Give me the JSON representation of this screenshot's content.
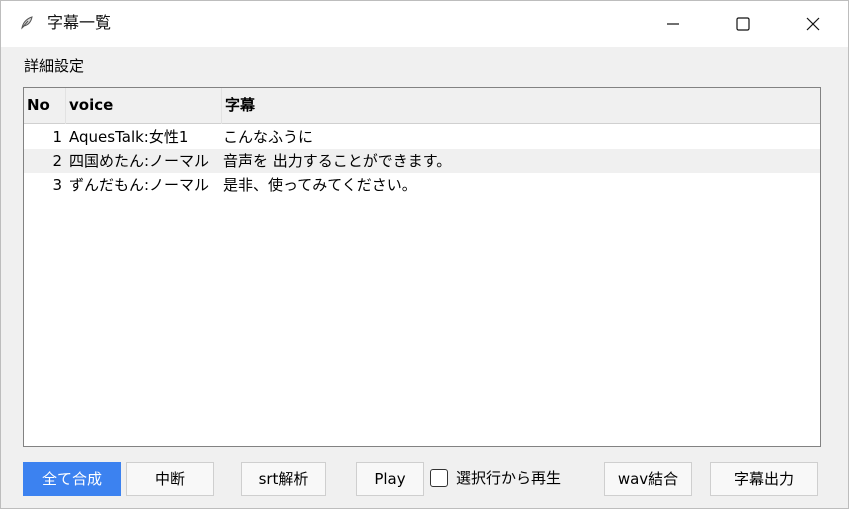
{
  "window": {
    "title": "字幕一覧",
    "icon": "feather-app-icon",
    "controls": {
      "minimize": "minimize-icon",
      "maximize": "maximize-icon",
      "close": "close-icon"
    }
  },
  "menu": {
    "settings_label": "詳細設定"
  },
  "table": {
    "columns": [
      "No",
      "voice",
      "字幕"
    ],
    "rows": [
      {
        "no": "1",
        "voice": "AquesTalk:女性1",
        "subtitle": "こんなふうに"
      },
      {
        "no": "2",
        "voice": "四国めたん:ノーマル",
        "subtitle": "音声を 出力することができます。"
      },
      {
        "no": "3",
        "voice": "ずんだもん:ノーマル",
        "subtitle": "是非、使ってみてください。"
      }
    ]
  },
  "toolbar": {
    "synthesize_all": "全て合成",
    "abort": "中断",
    "srt_parse": "srt解析",
    "play": "Play",
    "play_from_selected_label": "選択行から再生",
    "play_from_selected_checked": false,
    "wav_merge": "wav結合",
    "subtitle_output": "字幕出力"
  },
  "colors": {
    "primary_button": "#3c82f0",
    "window_bg": "#f0f0f0",
    "alt_row": "#f0f0f0"
  }
}
